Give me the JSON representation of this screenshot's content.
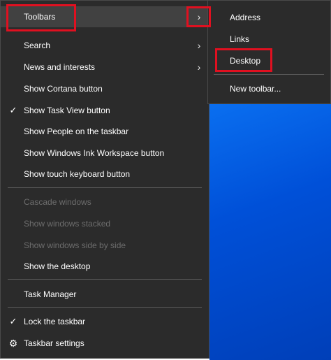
{
  "menu": {
    "items": [
      {
        "label": "Toolbars",
        "submenu": true,
        "highlighted": true
      },
      {
        "label": "Search",
        "submenu": true
      },
      {
        "label": "News and interests",
        "submenu": true
      },
      {
        "label": "Show Cortana button"
      },
      {
        "label": "Show Task View button",
        "checked": true
      },
      {
        "label": "Show People on the taskbar"
      },
      {
        "label": "Show Windows Ink Workspace button"
      },
      {
        "label": "Show touch keyboard button"
      },
      {
        "label": "Cascade windows",
        "disabled": true
      },
      {
        "label": "Show windows stacked",
        "disabled": true
      },
      {
        "label": "Show windows side by side",
        "disabled": true
      },
      {
        "label": "Show the desktop"
      },
      {
        "label": "Task Manager"
      },
      {
        "label": "Lock the taskbar",
        "checked": true
      },
      {
        "label": "Taskbar settings",
        "icon": "gear-icon"
      }
    ]
  },
  "submenu": {
    "items": [
      {
        "label": "Address"
      },
      {
        "label": "Links"
      },
      {
        "label": "Desktop",
        "highlighted": true
      },
      {
        "label": "New toolbar..."
      }
    ]
  },
  "glyphs": {
    "chevron": "›",
    "check": "✓",
    "gear": "⚙"
  },
  "colors": {
    "menu_bg": "#2b2b2b",
    "hover_bg": "#414141",
    "highlight_box": "#e01020",
    "desktop_blue": "#0050d8"
  }
}
